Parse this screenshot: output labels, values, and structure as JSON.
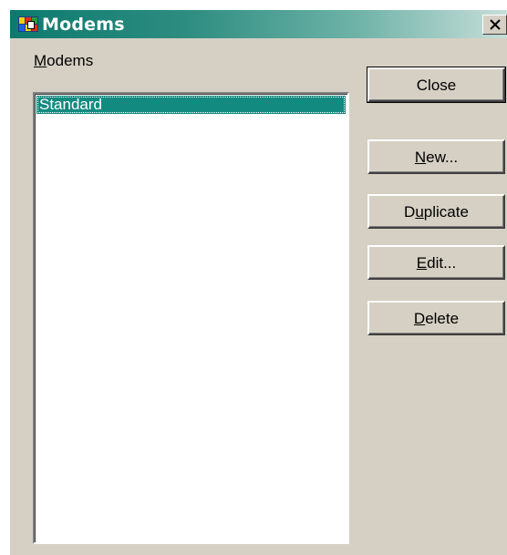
{
  "window": {
    "title": "Modems"
  },
  "list": {
    "label_underline": "M",
    "label_rest": "odems",
    "items": [
      "Standard"
    ],
    "selected_index": 0
  },
  "buttons": {
    "close": {
      "pre": "",
      "u": "",
      "post": "Close"
    },
    "new": {
      "pre": "",
      "u": "N",
      "post": "ew..."
    },
    "duplicate": {
      "pre": "D",
      "u": "u",
      "post": "plicate"
    },
    "edit": {
      "pre": "",
      "u": "E",
      "post": "dit..."
    },
    "delete": {
      "pre": "",
      "u": "D",
      "post": "elete"
    }
  },
  "colors": {
    "titlebar_start": "#0d7a6e",
    "titlebar_end": "#c6ded8",
    "selection": "#138a80",
    "face": "#d6d0c4"
  }
}
